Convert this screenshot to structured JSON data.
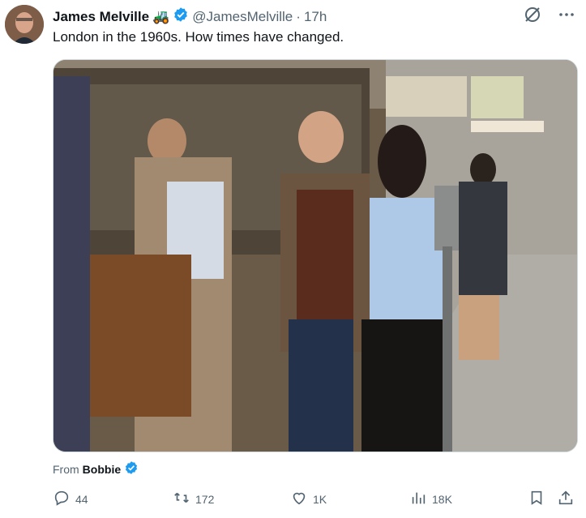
{
  "tweet": {
    "author_name": "James Melville",
    "author_emoji": "🚜",
    "handle": "@JamesMelville",
    "separator": "·",
    "time": "17h",
    "text": "London in the 1960s. How times have changed.",
    "from_label": "From",
    "from_name": "Bobbie"
  },
  "actions": {
    "replies": "44",
    "reposts": "172",
    "likes": "1K",
    "views": "18K"
  },
  "colors": {
    "verified": "#1d9bf0",
    "muted": "#536471",
    "text": "#0f1419"
  }
}
